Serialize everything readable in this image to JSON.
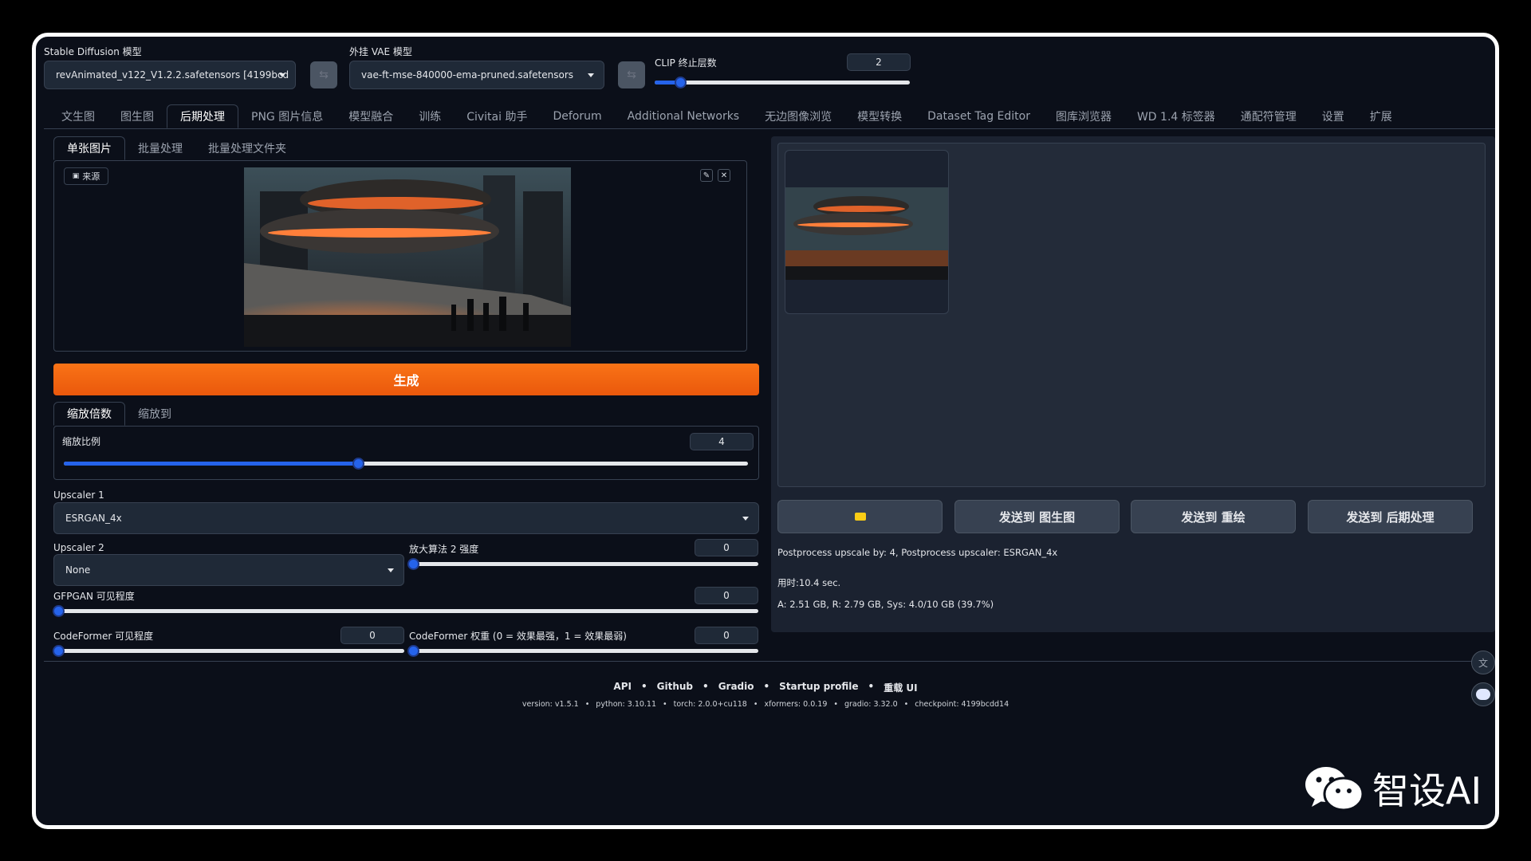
{
  "header": {
    "sd_model_label": "Stable Diffusion 模型",
    "sd_model_value": "revAnimated_v122_V1.2.2.safetensors [4199bcd",
    "vae_label": "外挂 VAE 模型",
    "vae_value": "vae-ft-mse-840000-ema-pruned.safetensors",
    "clip_label": "CLIP 终止层数",
    "clip_value": "2",
    "clip_level": 0.1
  },
  "tabs": [
    "文生图",
    "图生图",
    "后期处理",
    "PNG 图片信息",
    "模型融合",
    "训练",
    "Civitai 助手",
    "Deforum",
    "Additional Networks",
    "无边图像浏览",
    "模型转换",
    "Dataset Tag Editor",
    "图库浏览器",
    "WD 1.4 标签器",
    "通配符管理",
    "设置",
    "扩展"
  ],
  "subtabs": [
    "单张图片",
    "批量处理",
    "批量处理文件夹"
  ],
  "source_label": "来源",
  "generate_label": "生成",
  "scale_tabs": [
    "缩放倍数",
    "缩放到"
  ],
  "scale": {
    "label": "缩放比例",
    "value": "4",
    "level": 0.43
  },
  "upscaler1": {
    "label": "Upscaler 1",
    "value": "ESRGAN_4x"
  },
  "upscaler2": {
    "label": "Upscaler 2",
    "value": "None"
  },
  "upscaler2_strength": {
    "label": "放大算法 2 强度",
    "value": "0",
    "level": 0
  },
  "gfpgan": {
    "label": "GFPGAN 可见程度",
    "value": "0",
    "level": 0
  },
  "codeformer_vis": {
    "label": "CodeFormer 可见程度",
    "value": "0",
    "level": 0
  },
  "codeformer_weight": {
    "label": "CodeFormer 权重 (0 = 效果最强，1 = 效果最弱)",
    "value": "0",
    "level": 0
  },
  "actions": [
    "发送到 图生图",
    "发送到 重绘",
    "发送到 后期处理"
  ],
  "output_info": {
    "line1": "Postprocess upscale by: 4, Postprocess upscaler: ESRGAN_4x",
    "line2": "用时:10.4 sec.",
    "line3": "A: 2.51 GB, R: 2.79 GB, Sys: 4.0/10 GB (39.7%)"
  },
  "footer": {
    "links": [
      "API",
      "Github",
      "Gradio",
      "Startup profile",
      "重载 UI"
    ],
    "versions": [
      "version: v1.5.1",
      "python: 3.10.11",
      "torch: 2.0.0+cu118",
      "xformers: 0.0.19",
      "gradio: 3.32.0",
      "checkpoint: 4199bcdd14"
    ]
  },
  "watermark": "智设AI",
  "colors": {
    "accent": "#f97316",
    "slider": "#2563eb",
    "bg": "#0b0f19"
  }
}
